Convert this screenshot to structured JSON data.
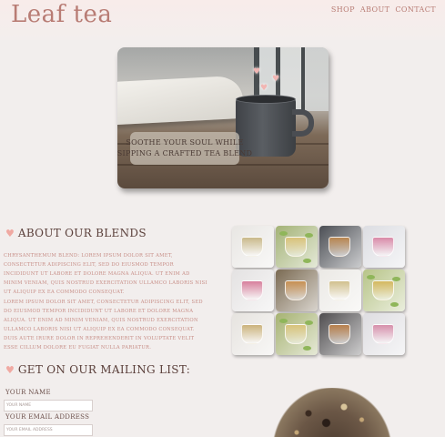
{
  "brand": {
    "logo": "Leaf tea"
  },
  "nav": {
    "items": [
      "SHOP",
      "ABOUT",
      "CONTACT"
    ]
  },
  "hero": {
    "caption_line1": "SOOTHE YOUR SOUL WHILE",
    "caption_line2": "SIPPING A CRAFTED TEA BLEND"
  },
  "about": {
    "heading": "ABOUT OUR BLENDS",
    "paragraph1": "CHRYSANTHEMUM BLEND: LOREM IPSUM DOLOR SIT AMET, CONSECTETUR ADIPISCING ELIT, SED DO EIUSMOD TEMPOR INCIDIDUNT UT LABORE ET DOLORE MAGNA ALIQUA. UT ENIM AD MINIM VENIAM, QUIS NOSTRUD EXERCITATION ULLAMCO LABORIS NISI UT ALIQUIP EX EA COMMODO CONSEQUAT.",
    "paragraph2": "LOREM IPSUM DOLOR SIT AMET, CONSECTETUR ADIPISCING ELIT, SED DO EIUSMOD TEMPOR INCIDIDUNT UT LABORE ET DOLORE MAGNA ALIQUA. UT ENIM AD MINIM VENIAM, QUIS NOSTRUD EXERCITATION ULLAMCO LABORIS NISI UT ALIQUIP EX EA COMMODO CONSEQUAT. DUIS AUTE IRURE DOLOR IN REPREHENDERIT IN VOLUPTATE VELIT ESSE CILLUM DOLORE EU FUGIAT NULLA PARIATUR."
  },
  "mailing": {
    "heading": "GET ON OUR MAILING LIST:",
    "name_label": "YOUR NAME",
    "name_placeholder": "YOUR NAME",
    "email_label": "YOUR EMAIL ADDRESS",
    "email_placeholder": "YOUR EMAIL ADDRESS"
  },
  "colors": {
    "accent": "#b87c74",
    "heart": "#f0a9a2",
    "paragraph": "#c78d86",
    "background": "#f2eeed"
  },
  "icons": {
    "heading_icon": "heart-icon"
  },
  "gallery": {
    "tiles": [
      {
        "bg": "#e8e6e3",
        "liquid": "#c9b98a",
        "leaf": false
      },
      {
        "bg": "#a3b276",
        "liquid": "#d9c27a",
        "leaf": true
      },
      {
        "bg": "#4b4e54",
        "liquid": "#b98650",
        "leaf": false
      },
      {
        "bg": "#dcdde2",
        "liquid": "#d98aa8",
        "leaf": false
      },
      {
        "bg": "#e4e2e2",
        "liquid": "#d77f9c",
        "leaf": false
      },
      {
        "bg": "#7a6a52",
        "liquid": "#c79053",
        "leaf": false
      },
      {
        "bg": "#ebe9e5",
        "liquid": "#d1c08d",
        "leaf": false
      },
      {
        "bg": "#b7c488",
        "liquid": "#d4b860",
        "leaf": true
      },
      {
        "bg": "#e6e3df",
        "liquid": "#cbb37c",
        "leaf": false
      },
      {
        "bg": "#a6b272",
        "liquid": "#d8c37b",
        "leaf": true
      },
      {
        "bg": "#4f4d4f",
        "liquid": "#b8804c",
        "leaf": false
      },
      {
        "bg": "#dedde1",
        "liquid": "#d68fab",
        "leaf": false
      }
    ]
  }
}
